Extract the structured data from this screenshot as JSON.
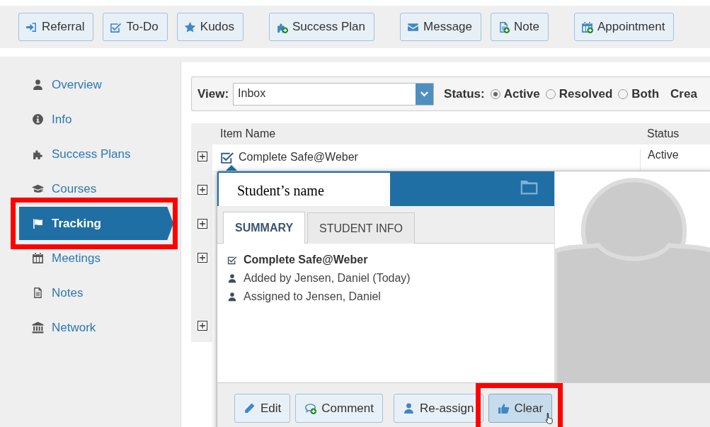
{
  "toolbar": {
    "groups": [
      [
        {
          "label": "Referral"
        },
        {
          "label": "To-Do"
        },
        {
          "label": "Kudos"
        }
      ],
      [
        {
          "label": "Success Plan"
        }
      ],
      [
        {
          "label": "Message"
        },
        {
          "label": "Note"
        }
      ],
      [
        {
          "label": "Appointment"
        }
      ]
    ]
  },
  "sidebar": {
    "items": [
      {
        "label": "Overview",
        "selected": false,
        "highlighted": false
      },
      {
        "label": "Info",
        "selected": false,
        "highlighted": false
      },
      {
        "label": "Success Plans",
        "selected": false,
        "highlighted": false
      },
      {
        "label": "Courses",
        "selected": false,
        "highlighted": false
      },
      {
        "label": "Tracking",
        "selected": true,
        "highlighted": true
      },
      {
        "label": "Meetings",
        "selected": false,
        "highlighted": false
      },
      {
        "label": "Notes",
        "selected": false,
        "highlighted": false
      },
      {
        "label": "Network",
        "selected": false,
        "highlighted": false
      }
    ]
  },
  "filter": {
    "view_label": "View:",
    "view_value": "Inbox",
    "status_label": "Status:",
    "status_options": [
      {
        "label": "Active",
        "selected": true
      },
      {
        "label": "Resolved",
        "selected": false
      },
      {
        "label": "Both",
        "selected": false
      }
    ],
    "column_3": "Crea"
  },
  "table": {
    "columns": [
      "Item Name",
      "Status"
    ],
    "rows": [
      {
        "expandable": true,
        "item_name": "Complete Safe@Weber",
        "status": "Active"
      },
      {
        "expandable": true
      },
      {
        "expandable": true
      },
      {
        "expandable": true
      },
      {
        "expandable": false
      },
      {
        "expandable": true
      }
    ]
  },
  "popup": {
    "name_label": "Student’s name",
    "tabs": [
      {
        "label": "SUMMARY",
        "selected": true
      },
      {
        "label": "STUDENT INFO",
        "selected": false
      }
    ],
    "details": [
      {
        "kind": "task",
        "text": "Complete Safe@Weber"
      },
      {
        "kind": "person",
        "text": "Added by Jensen, Daniel (Today)"
      },
      {
        "kind": "person",
        "text": "Assigned to Jensen, Daniel"
      }
    ],
    "buttons": [
      {
        "label": "Edit",
        "pressed": false,
        "highlighted": false
      },
      {
        "label": "Comment",
        "pressed": false,
        "highlighted": false
      },
      {
        "label": "Re-assign",
        "pressed": false,
        "highlighted": false
      },
      {
        "label": "Clear",
        "pressed": true,
        "highlighted": true
      }
    ]
  }
}
